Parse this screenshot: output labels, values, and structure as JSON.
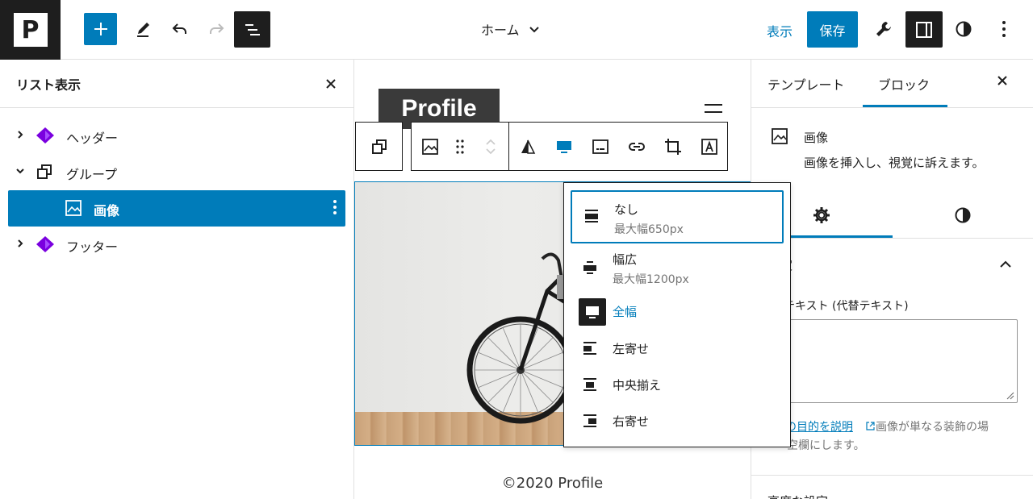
{
  "topbar": {
    "logo_letter": "P",
    "document_title": "ホーム",
    "view_label": "表示",
    "save_label": "保存"
  },
  "list_view": {
    "title": "リスト表示",
    "items": [
      {
        "label": "ヘッダー"
      },
      {
        "label": "グループ"
      },
      {
        "label": "画像"
      },
      {
        "label": "フッター"
      }
    ]
  },
  "canvas": {
    "site_title": "Profile",
    "footer_text": "©2020 Profile"
  },
  "align_menu": {
    "options": [
      {
        "label": "なし",
        "sub": "最大幅650px"
      },
      {
        "label": "幅広",
        "sub": "最大幅1200px"
      },
      {
        "label": "全幅"
      },
      {
        "label": "左寄せ"
      },
      {
        "label": "中央揃え"
      },
      {
        "label": "右寄せ"
      }
    ]
  },
  "sidebar": {
    "tabs": [
      "テンプレート",
      "ブロック"
    ],
    "block_name": "画像",
    "block_description": "画像を挿入し、視覚に訴えます。",
    "section_label_partial": "定",
    "alt_label": "テキスト (代替テキスト)",
    "help_link": "の目的を説明",
    "help_text_1": "画像が単なる装飾の場",
    "help_text_2": "空欄にします。",
    "advanced_label": "高度な設定"
  },
  "colors": {
    "accent": "#007cba",
    "dark": "#1e1e1e",
    "block_icon_purple": "#7a00df"
  }
}
